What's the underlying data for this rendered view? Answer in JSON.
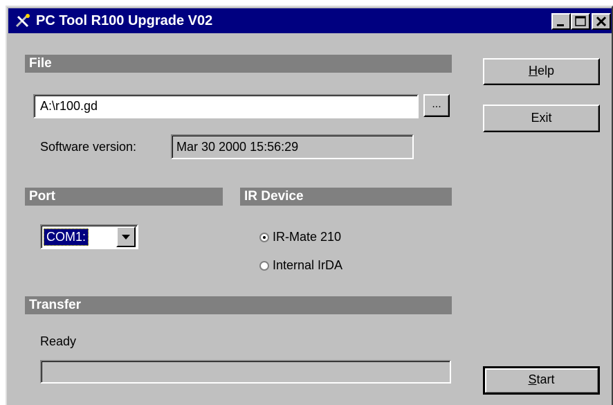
{
  "window": {
    "title": "PC Tool R100 Upgrade V02",
    "icon": "tools-icon",
    "controls": {
      "minimize": "minimize-icon",
      "maximize": "maximize-icon",
      "close": "close-icon"
    }
  },
  "file_section": {
    "header": "File",
    "path_value": "A:\\r100.gd",
    "browse_label": "...",
    "version_label": "Software version:",
    "version_value": "Mar 30 2000 15:56:29"
  },
  "port_section": {
    "header": "Port",
    "selected": "COM1:"
  },
  "ir_section": {
    "header": "IR Device",
    "options": [
      {
        "label": "IR-Mate 210",
        "checked": true
      },
      {
        "label": "Internal IrDA",
        "checked": false
      }
    ]
  },
  "transfer_section": {
    "header": "Transfer",
    "status": "Ready",
    "progress": 0
  },
  "buttons": {
    "help_prefix": "H",
    "help_rest": "elp",
    "exit": "Exit",
    "start_prefix": "S",
    "start_rest": "tart"
  }
}
